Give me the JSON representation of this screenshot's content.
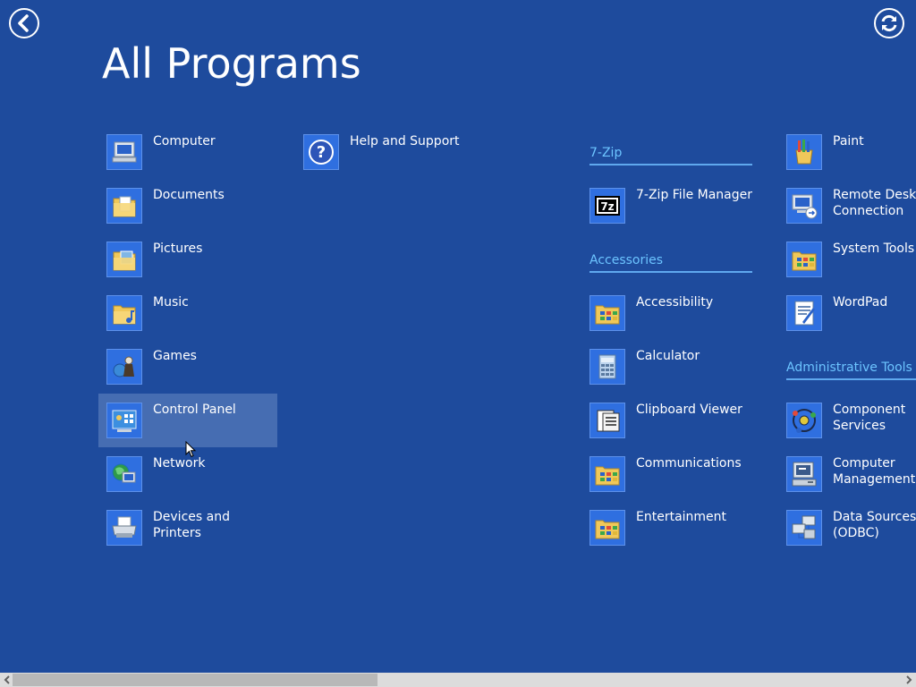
{
  "title": "All Programs",
  "nav": {
    "back_icon": "back-arrow-icon",
    "refresh_icon": "refresh-icon"
  },
  "col1": [
    {
      "label": "Computer",
      "icon": "computer-icon"
    },
    {
      "label": "Documents",
      "icon": "documents-folder-icon"
    },
    {
      "label": "Pictures",
      "icon": "pictures-folder-icon"
    },
    {
      "label": "Music",
      "icon": "music-folder-icon"
    },
    {
      "label": "Games",
      "icon": "games-icon"
    },
    {
      "label": "Control Panel",
      "icon": "control-panel-icon",
      "highlighted": true
    },
    {
      "label": "Network",
      "icon": "network-icon"
    },
    {
      "label": "Devices and\nPrinters",
      "icon": "printer-icon"
    }
  ],
  "col2": [
    {
      "label": "Help and Support",
      "icon": "help-icon"
    }
  ],
  "groups": {
    "sevenzip": {
      "header": "7-Zip",
      "items": [
        {
          "label": "7-Zip File Manager",
          "icon": "7zip-icon"
        }
      ]
    },
    "accessories": {
      "header": "Accessories",
      "items": [
        {
          "label": "Accessibility",
          "icon": "folder-icon"
        },
        {
          "label": "Calculator",
          "icon": "calculator-icon"
        },
        {
          "label": "Clipboard Viewer",
          "icon": "clipboard-icon"
        },
        {
          "label": "Communications",
          "icon": "folder-icon"
        },
        {
          "label": "Entertainment",
          "icon": "folder-icon"
        }
      ]
    },
    "accessories_more": [
      {
        "label": "Paint",
        "icon": "paint-icon"
      },
      {
        "label": "Remote Deskt\nConnection",
        "icon": "remote-desktop-icon"
      },
      {
        "label": "System Tools",
        "icon": "folder-icon"
      },
      {
        "label": "WordPad",
        "icon": "wordpad-icon"
      }
    ],
    "admin": {
      "header": "Administrative Tools",
      "items": [
        {
          "label": "Component\nServices",
          "icon": "component-services-icon"
        },
        {
          "label": "Computer\nManagement",
          "icon": "computer-management-icon"
        },
        {
          "label": "Data Sources\n(ODBC)",
          "icon": "data-sources-icon"
        }
      ]
    }
  },
  "scrollbar": {
    "left_icon": "scroll-left-icon",
    "right_icon": "scroll-right-icon",
    "position": 0.0
  },
  "colors": {
    "background": "#1e4b9d",
    "accent": "#6cc4ff",
    "tile": "#2f6fe0"
  }
}
